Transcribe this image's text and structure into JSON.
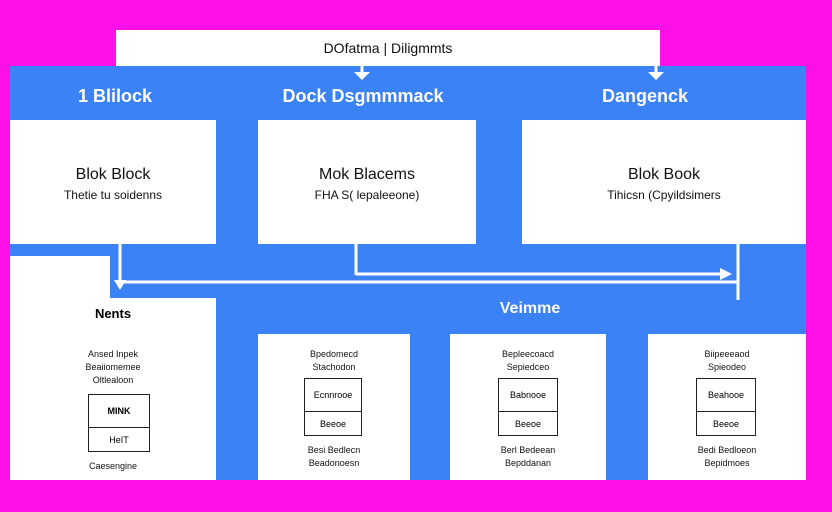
{
  "title": "DOfatma | Diligmmts",
  "headers": [
    "1 Blilock",
    "Dock Dsgmmmack",
    "Dangenck"
  ],
  "top_boxes": [
    {
      "title": "Blok Block",
      "subtitle": "Thetie tu soidenns"
    },
    {
      "title": "Mok Blacems",
      "subtitle": "FHA S( lepaleeone)"
    },
    {
      "title": "Blok Book",
      "subtitle": "Tihicsn (Cpyildsimers"
    }
  ],
  "left_panel": {
    "title": "Nents",
    "lines": [
      "Ansed Inpek",
      "Beaiiomemee",
      "Oltlealoon"
    ],
    "table_rows": [
      "MINK",
      "HeIT"
    ],
    "footer": "Caesengine"
  },
  "mid_label": "Veimme",
  "bottom_boxes": [
    {
      "lines": [
        "Bpedomecd",
        "Stachodon"
      ],
      "table_rows": [
        "Ecnnrooe",
        "Beeoe"
      ],
      "footer": [
        "Besi Bedlecn",
        "Beadonoesn"
      ]
    },
    {
      "lines": [
        "Bepleecoacd",
        "Sepiedceo"
      ],
      "table_rows": [
        "Babnooe",
        "Beeoe"
      ],
      "footer": [
        "Berl Bedeean",
        "Bepddanan"
      ]
    },
    {
      "lines": [
        "Biipeeeaod",
        "Spieodeo"
      ],
      "table_rows": [
        "Beahooe",
        "Beeoe"
      ],
      "footer": [
        "Bedi Bedloeon",
        "Bepidmoes"
      ]
    }
  ]
}
